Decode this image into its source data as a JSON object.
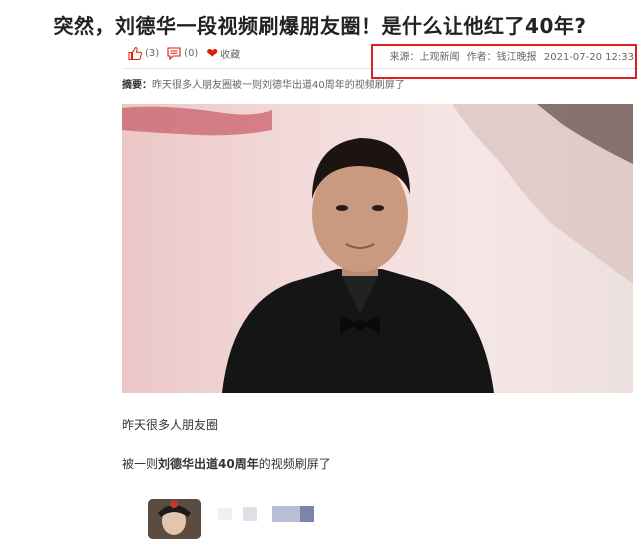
{
  "article": {
    "title": "突然，刘德华一段视频刷爆朋友圈！是什么让他红了40年?",
    "like_count": "(3)",
    "comment_count": "(0)",
    "favorite_label": "收藏",
    "source_label": "来源：上观新闻",
    "author_label": "作者：钱江晚报",
    "datetime": "2021-07-20 12:33",
    "summary_label": "摘要：",
    "summary_text": "昨天很多人朋友圈被一则刘德华出道40周年的视频刷屏了",
    "paragraph1": "昨天很多人朋友圈",
    "paragraph2_prefix": "被一则",
    "paragraph2_bold": "刘德华出道40周年",
    "paragraph2_suffix": "的视频刷屏了"
  },
  "icons": {
    "like": "thumbs-up-icon",
    "comment": "comment-icon",
    "favorite": "heart-icon"
  },
  "colors": {
    "highlight_box": "#e02020",
    "favorite_heart": "#d81e06"
  }
}
